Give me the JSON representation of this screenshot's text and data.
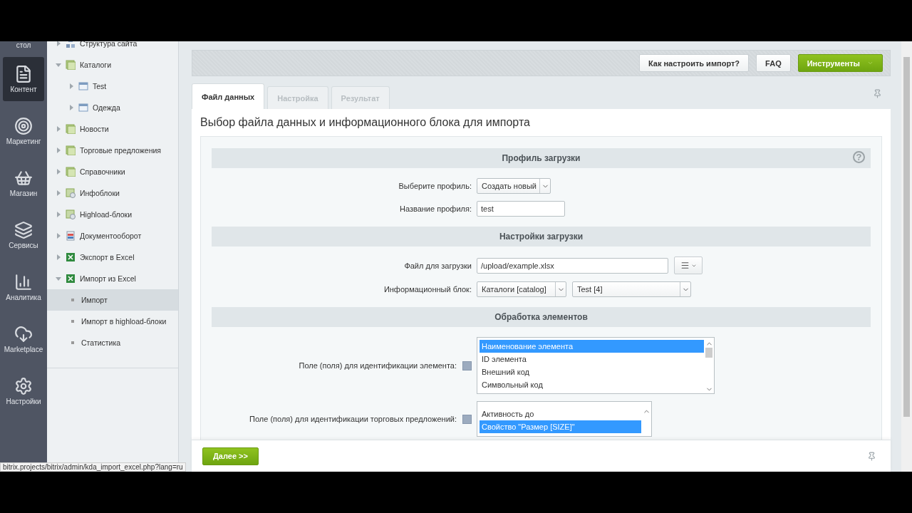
{
  "sidebar": {
    "items": [
      {
        "label": "стол",
        "kind": "desk",
        "selected": false
      },
      {
        "label": "Контент",
        "kind": "content",
        "selected": true
      },
      {
        "label": "Маркетинг",
        "kind": "marketing",
        "selected": false
      },
      {
        "label": "Магазин",
        "kind": "shop",
        "selected": false
      },
      {
        "label": "Сервисы",
        "kind": "services",
        "selected": false
      },
      {
        "label": "Аналитика",
        "kind": "analytics",
        "selected": false
      },
      {
        "label": "Marketplace",
        "kind": "marketplace",
        "selected": false
      },
      {
        "label": "Настройки",
        "kind": "settings",
        "selected": false
      }
    ]
  },
  "tree": [
    {
      "label": "Структура сайта",
      "kind": "site",
      "expanded": false,
      "selected": false
    },
    {
      "label": "Каталоги",
      "kind": "section",
      "expanded": true,
      "selected": false,
      "children": [
        {
          "label": "Test",
          "kind": "catalog",
          "expanded": false,
          "selected": false
        },
        {
          "label": "Одежда",
          "kind": "catalog",
          "expanded": false,
          "selected": false
        }
      ]
    },
    {
      "label": "Новости",
      "kind": "section",
      "expanded": false,
      "selected": false
    },
    {
      "label": "Торговые предложения",
      "kind": "section",
      "expanded": false,
      "selected": false
    },
    {
      "label": "Справочники",
      "kind": "section",
      "expanded": false,
      "selected": false
    },
    {
      "label": "Инфоблоки",
      "kind": "iblock",
      "expanded": false,
      "selected": false
    },
    {
      "label": "Highload-блоки",
      "kind": "iblock",
      "expanded": false,
      "selected": false
    },
    {
      "label": "Документооборот",
      "kind": "docflow",
      "expanded": false,
      "selected": false
    },
    {
      "label": "Экспорт в Excel",
      "kind": "excel",
      "expanded": false,
      "selected": false
    },
    {
      "label": "Импорт из Excel",
      "kind": "excel",
      "expanded": true,
      "selected": false,
      "children": [
        {
          "label": "Импорт",
          "kind": "page",
          "selected": true
        },
        {
          "label": "Импорт в highload-блоки",
          "kind": "page",
          "selected": false
        },
        {
          "label": "Статистика",
          "kind": "page",
          "selected": false
        }
      ]
    }
  ],
  "toolbar": {
    "buttons": [
      {
        "label": "Как настроить импорт?",
        "kind": "plain"
      },
      {
        "label": "FAQ",
        "kind": "plain"
      },
      {
        "label": "Инструменты",
        "kind": "menu"
      }
    ]
  },
  "tabs": [
    {
      "label": "Файл данных",
      "selected": true,
      "disabled": false
    },
    {
      "label": "Настройка",
      "selected": false,
      "disabled": true
    },
    {
      "label": "Результат",
      "selected": false,
      "disabled": true
    }
  ],
  "page_title": "Выбор файла данных и информационного блока для импорта",
  "sections": [
    {
      "title": "Профиль загрузки",
      "help": "?",
      "rows": [
        {
          "label": "Выберите профиль:",
          "kind": "select",
          "value": "Создать новый"
        },
        {
          "label": "Название профиля:",
          "kind": "input",
          "value": "test"
        }
      ]
    },
    {
      "title": "Настройки загрузки",
      "rows": [
        {
          "label": "Файл для загрузки",
          "kind": "file",
          "value": "/upload/example.xlsx"
        },
        {
          "label": "Информационный блок:",
          "kind": "select-pair",
          "value": "Каталоги [catalog]",
          "value_2": "Test [4]"
        }
      ]
    },
    {
      "title": "Обработка элементов",
      "rows": [
        {
          "label": "Поле (поля) для идентификации элемента:",
          "kind": "listbox",
          "help": true,
          "options": [
            {
              "label": "Наименование элемента",
              "selected": true
            },
            {
              "label": "ID элемента",
              "selected": false
            },
            {
              "label": "Внешний код",
              "selected": false
            },
            {
              "label": "Символьный код",
              "selected": false
            }
          ]
        },
        {
          "label": "Поле (поля) для идентификации торговых предложений:",
          "kind": "listbox-narrow",
          "help": true,
          "options": [
            {
              "label": "Активность до",
              "selected": false
            },
            {
              "label": "Свойство \"Размер [SIZE]\"",
              "selected": true
            }
          ]
        }
      ]
    }
  ],
  "next_button": "Далее >>",
  "status_url": "bitrix.projects/bitrix/admin/kda_import_excel.php?lang=ru"
}
